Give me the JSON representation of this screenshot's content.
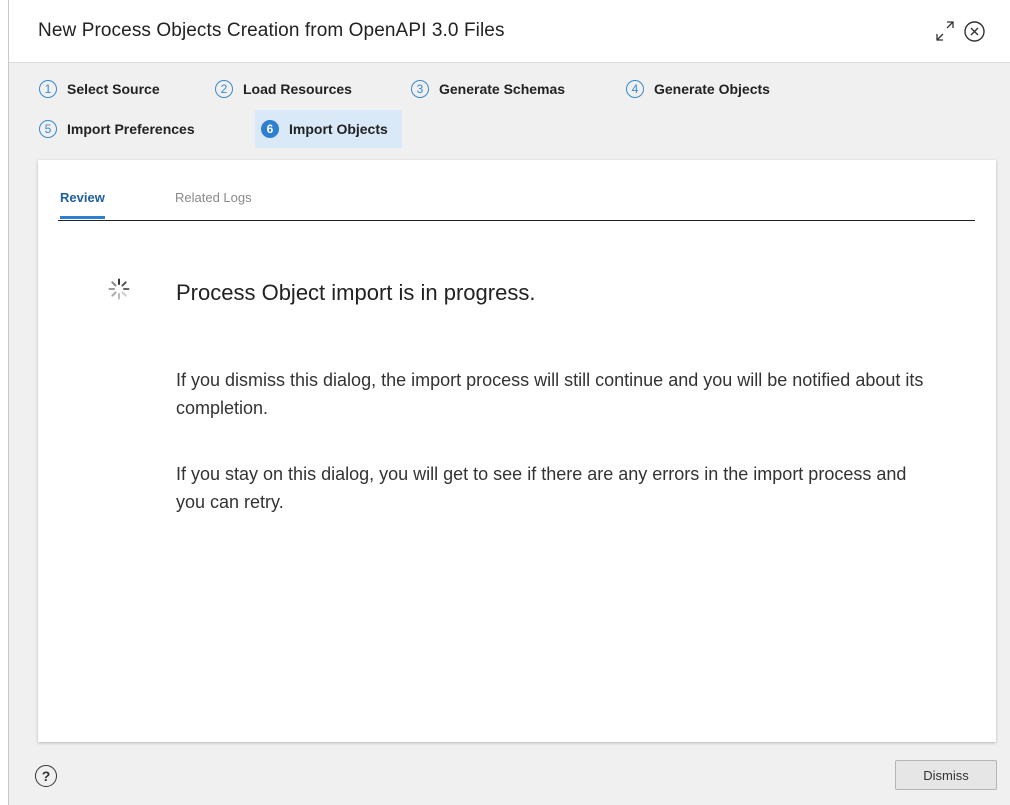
{
  "dialog": {
    "title": "New Process Objects Creation from OpenAPI 3.0 Files",
    "expand_icon": "expand-icon",
    "close_icon": "close-circle-icon"
  },
  "steps": [
    {
      "number": "1",
      "label": "Select Source",
      "active": false
    },
    {
      "number": "2",
      "label": "Load Resources",
      "active": false
    },
    {
      "number": "3",
      "label": "Generate Schemas",
      "active": false
    },
    {
      "number": "4",
      "label": "Generate Objects",
      "active": false
    },
    {
      "number": "5",
      "label": "Import Preferences",
      "active": false
    },
    {
      "number": "6",
      "label": "Import Objects",
      "active": true
    }
  ],
  "tabs": [
    {
      "label": "Review",
      "active": true
    },
    {
      "label": "Related Logs",
      "active": false
    }
  ],
  "review": {
    "spinner_icon": "loading-spinner-icon",
    "headline": "Process Object import is in progress.",
    "paragraphs": [
      "If you dismiss this dialog, the import process will still continue and you will be notified about its completion.",
      "If you stay on this dialog, you will get to see if there are any errors in the import process and you can retry."
    ]
  },
  "footer": {
    "help_icon": "help-icon",
    "help_glyph": "?",
    "dismiss_label": "Dismiss"
  },
  "colors": {
    "accent": "#2f7fd0",
    "active_step_bg": "#d9e9f7",
    "dialog_bg": "#f0f0f0"
  }
}
